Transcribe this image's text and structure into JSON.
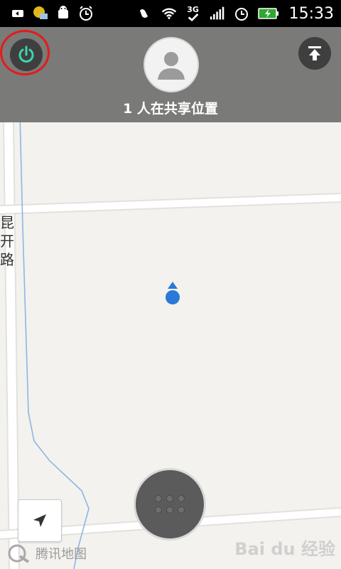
{
  "status_bar": {
    "time": "15:33",
    "network": "3G",
    "icons_left": [
      "usb-icon",
      "notification-app-icon",
      "android-debug-icon",
      "alarm-icon"
    ],
    "icons_right": [
      "signal-cut-icon",
      "wifi-icon",
      "3g-icon",
      "cellular-signal-icon",
      "alarm-clock-icon",
      "battery-charging-icon"
    ]
  },
  "header": {
    "share_text": "1 人在共享位置",
    "power_button": "power-icon",
    "upload_button": "upload-icon"
  },
  "map": {
    "road_label": "昆开路",
    "road_color": "#ffffff",
    "river_color": "#8fb5e3",
    "location_color": "#2a79d8"
  },
  "footer": {
    "brand": "腾讯地图",
    "watermark": "Bai du 经验"
  }
}
